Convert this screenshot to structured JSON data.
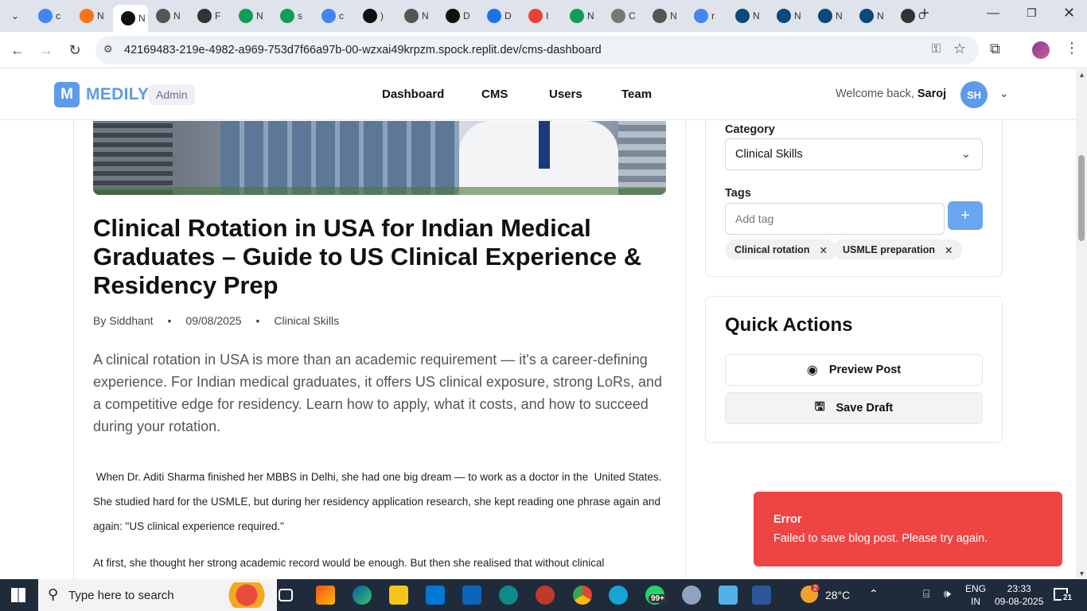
{
  "browser": {
    "url": "42169483-219e-4982-a969-753d7f66a97b-00-wzxai49krpzm.spock.replit.dev/cms-dashboard",
    "tabs": [
      {
        "label": "c",
        "color": "#4285f4"
      },
      {
        "label": "N",
        "color": "#f97316"
      },
      {
        "label": "N",
        "color": "#111",
        "active": true
      },
      {
        "label": "N",
        "color": "#555"
      },
      {
        "label": "F",
        "color": "#333"
      },
      {
        "label": "N",
        "color": "#0f9d58"
      },
      {
        "label": "s",
        "color": "#0f9d58"
      },
      {
        "label": "c",
        "color": "#4285f4"
      },
      {
        "label": ")",
        "color": "#111"
      },
      {
        "label": "N",
        "color": "#555"
      },
      {
        "label": "D",
        "color": "#111"
      },
      {
        "label": "D",
        "color": "#1a73e8"
      },
      {
        "label": "I",
        "color": "#ea4335"
      },
      {
        "label": "N",
        "color": "#0f9d58"
      },
      {
        "label": "C",
        "color": "#777"
      },
      {
        "label": "N",
        "color": "#555"
      },
      {
        "label": "r",
        "color": "#4285f4"
      },
      {
        "label": "N",
        "color": "#0a4a7a"
      },
      {
        "label": "N",
        "color": "#0a4a7a"
      },
      {
        "label": "N",
        "color": "#0a4a7a"
      },
      {
        "label": "N",
        "color": "#0a4a7a"
      },
      {
        "label": "C",
        "color": "#333"
      }
    ]
  },
  "header": {
    "logo_letter": "M",
    "brand": "MEDILY",
    "role_badge": "Admin",
    "nav": [
      "Dashboard",
      "CMS",
      "Users",
      "Team"
    ],
    "welcome_prefix": "Welcome back,",
    "welcome_name": "Saroj",
    "avatar_initials": "SH"
  },
  "article": {
    "title": "Clinical Rotation in USA for Indian Medical Graduates – Guide to US Clinical Experience & Residency Prep",
    "author": "By Siddhant",
    "date": "09/08/2025",
    "category": "Clinical Skills",
    "meta_sep": "•",
    "lead": "A clinical rotation in USA is more than an academic requirement — it's a career-defining experience. For Indian medical graduates, it offers US clinical exposure, strong LoRs, and a competitive edge for residency. Learn how to apply, what it costs, and how to succeed during your rotation.",
    "para1": " When Dr. Aditi Sharma finished her MBBS in Delhi, she had one big dream — to work as a doctor in the  United States. She studied hard for the USMLE, but during her residency application research, she kept reading one phrase again and again: \"US clinical experience required.\"",
    "para2": "At first, she thought her strong academic record would be enough. But then she realised that without clinical"
  },
  "sidebar": {
    "category_label": "Category",
    "category_value": "Clinical Skills",
    "tags_label": "Tags",
    "tag_placeholder": "Add tag",
    "tags": [
      "Clinical rotation",
      "USMLE preparation"
    ],
    "quick_actions_title": "Quick Actions",
    "preview_label": "Preview Post",
    "save_label": "Save Draft"
  },
  "toast": {
    "title": "Error",
    "message": "Failed to save blog post. Please try again."
  },
  "taskbar": {
    "search_placeholder": "Type here to search",
    "temperature": "28°C",
    "language_line1": "ENG",
    "language_line2": "IN",
    "time": "23:33",
    "date": "09-08-2025",
    "notification_count": "21",
    "badge_99": "99+",
    "badge_2": "2"
  }
}
